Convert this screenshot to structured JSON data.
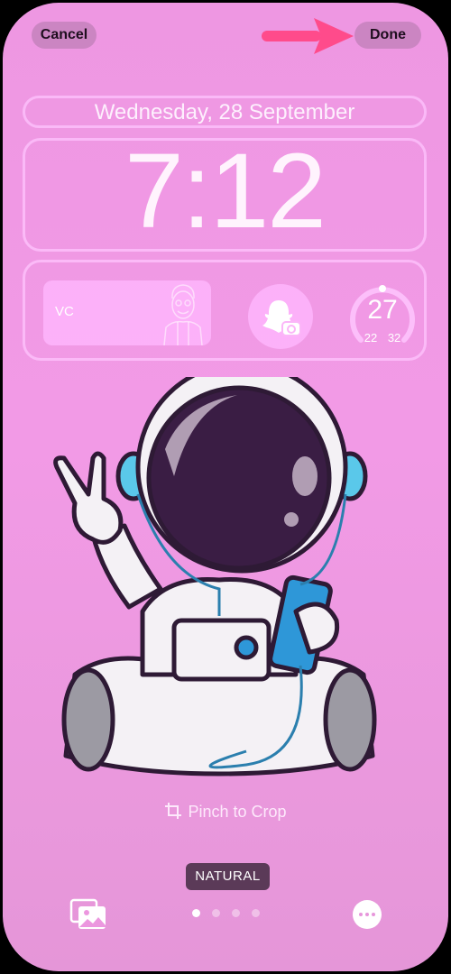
{
  "header": {
    "cancel_label": "Cancel",
    "done_label": "Done",
    "annotation_arrow_color": "#ff4b8b"
  },
  "lockscreen": {
    "date": "Wednesday, 28 September",
    "time": "7:12"
  },
  "widgets": {
    "contact": {
      "name": "VC",
      "icon": "bitmoji-avatar"
    },
    "snapchat": {
      "icon": "snapchat-camera-icon"
    },
    "weather": {
      "current": "27",
      "low": "22",
      "high": "32"
    }
  },
  "wallpaper": {
    "subject": "astronaut-illustration",
    "background_color": "#f29ae6"
  },
  "footer": {
    "crop_hint": "Pinch to Crop",
    "filter_label": "NATURAL",
    "page_count": 4,
    "active_page": 1,
    "gallery_icon": "photo-gallery-icon",
    "more_icon": "ellipsis-icon"
  }
}
